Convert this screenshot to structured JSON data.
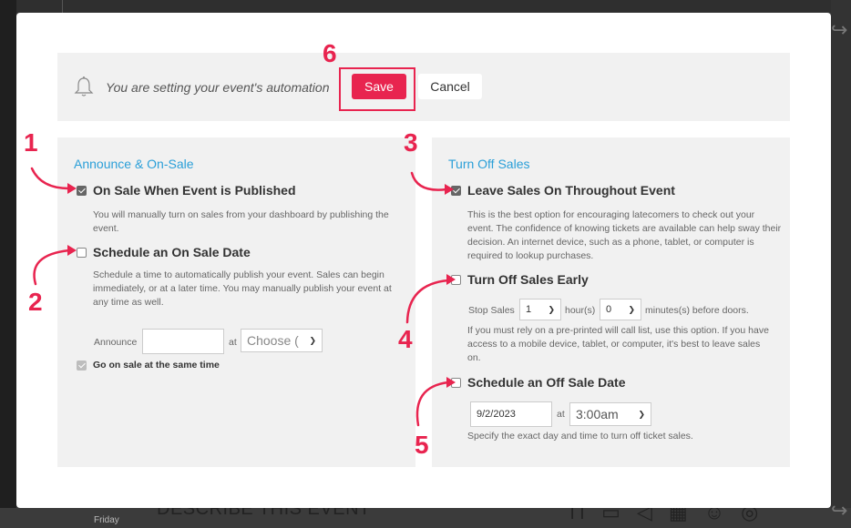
{
  "background": {
    "friday": "Friday",
    "describe": "DESCRIBE THIS EVENT"
  },
  "toolbar": {
    "message": "You are setting your event's automation",
    "save_label": "Save",
    "cancel_label": "Cancel"
  },
  "announce": {
    "title": "Announce & On-Sale",
    "on_sale_published": {
      "label": "On Sale When Event is Published",
      "checked": true,
      "desc": "You will manually turn on sales from your dashboard by publishing the event."
    },
    "schedule_on_sale": {
      "label": "Schedule an On Sale Date",
      "checked": false,
      "desc": "Schedule a time to automatically publish your event. Sales can begin immediately, or at a later time. You may manually publish your event at any time as well."
    },
    "announce_label": "Announce",
    "announce_value": "",
    "at_label": "at",
    "time_select": "Choose (",
    "same_time": {
      "label": "Go on sale at the same time",
      "checked": true
    }
  },
  "turn_off": {
    "title": "Turn Off Sales",
    "leave_on": {
      "label": "Leave Sales On Throughout Event",
      "checked": true,
      "desc": "This is the best option for encouraging latecomers to check out your event. The confidence of knowing tickets are available can help sway their decision. An internet device, such as a phone, tablet, or computer is required to lookup purchases."
    },
    "early": {
      "label": "Turn Off Sales Early",
      "checked": false,
      "stop_label": "Stop Sales",
      "hours_value": "1",
      "hours_label": "hour(s)",
      "minutes_value": "0",
      "minutes_label": "minutes(s) before doors.",
      "desc": "If you must rely on a pre-printed will call list, use this option. If you have access to a mobile device, tablet, or computer, it's best to leave sales on."
    },
    "off_date": {
      "label": "Schedule an Off Sale Date",
      "checked": false,
      "date_value": "9/2/2023",
      "at_label": "at",
      "time_value": "3:00am",
      "desc": "Specify the exact day and time to turn off ticket sales."
    }
  },
  "annotations": [
    "1",
    "2",
    "3",
    "4",
    "5",
    "6"
  ],
  "colors": {
    "accent": "#e8244f",
    "link": "#2a9fd8",
    "panel": "#f1f1f1"
  }
}
